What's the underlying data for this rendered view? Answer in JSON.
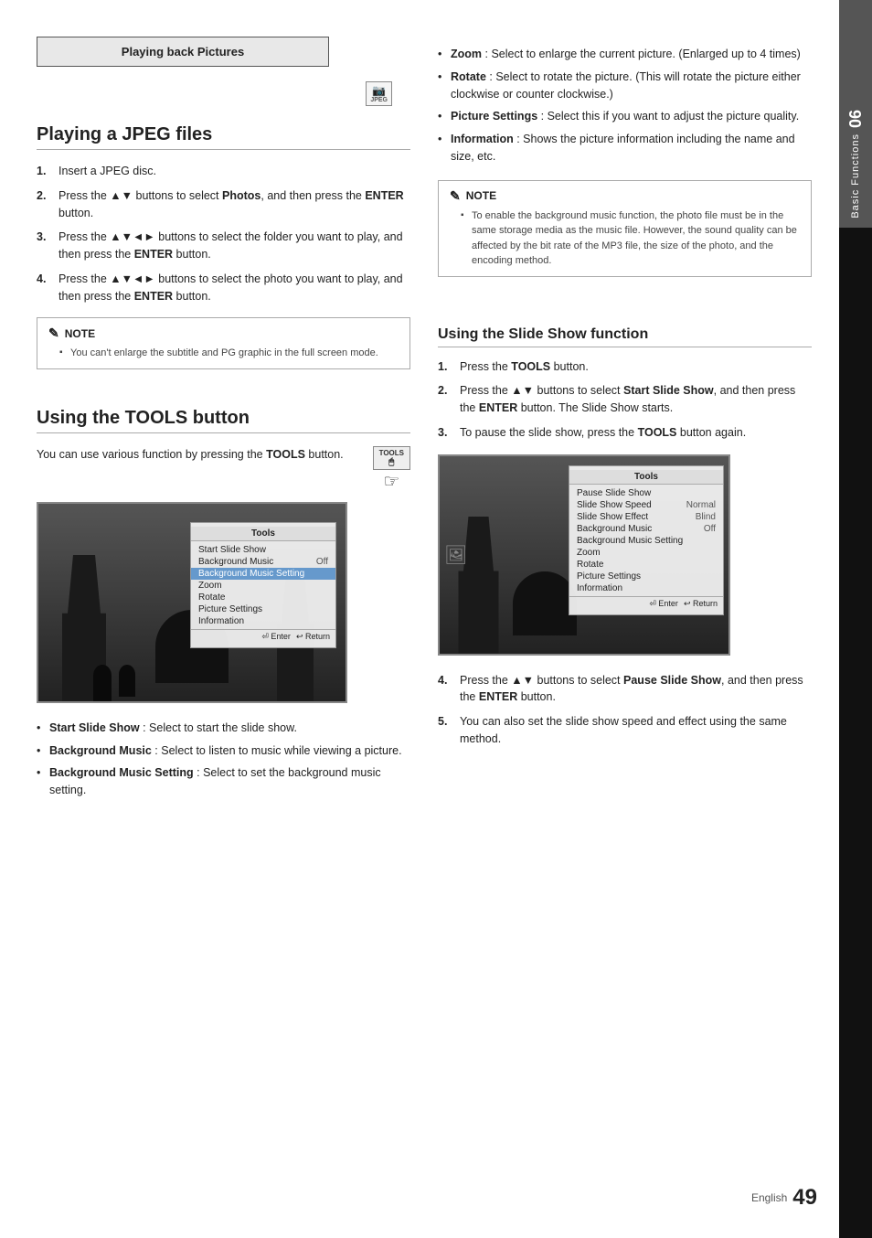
{
  "page": {
    "number": "49",
    "number_label": "English"
  },
  "side_tab": {
    "number": "06",
    "text": "Basic Functions"
  },
  "playing_back_box": {
    "title": "Playing back Pictures"
  },
  "jpeg_icon": {
    "label": "JPEG"
  },
  "left_section": {
    "title": "Playing a JPEG files",
    "steps": [
      {
        "num": "1.",
        "text": "Insert a JPEG disc."
      },
      {
        "num": "2.",
        "text": "Press the ▲▼ buttons to select Photos, and then press the ENTER button."
      },
      {
        "num": "3.",
        "text": "Press the ▲▼◄► buttons to select the folder you want to play, and then press the ENTER button."
      },
      {
        "num": "4.",
        "text": "Press the ▲▼◄► buttons to select the photo you want to play, and then press the ENTER button."
      }
    ],
    "note_title": "NOTE",
    "note_items": [
      "You can't enlarge the subtitle and PG graphic in the full screen mode."
    ]
  },
  "tools_section": {
    "title": "Using the TOOLS button",
    "intro": "You can use various function by pressing the TOOLS button.",
    "tools_label": "TOOLS",
    "popup": {
      "title": "Tools",
      "items": [
        {
          "text": "Start Slide Show",
          "value": "",
          "highlighted": false
        },
        {
          "text": "Background Music",
          "value": "Off",
          "highlighted": false
        },
        {
          "text": "Background Music Setting",
          "value": "",
          "highlighted": true
        },
        {
          "text": "Zoom",
          "value": "",
          "highlighted": false
        },
        {
          "text": "Rotate",
          "value": "",
          "highlighted": false
        },
        {
          "text": "Picture Settings",
          "value": "",
          "highlighted": false
        },
        {
          "text": "Information",
          "value": "",
          "highlighted": false
        }
      ],
      "footer_enter": "⏎ Enter",
      "footer_return": "↩ Return"
    },
    "bullets": [
      {
        "label": "Start Slide Show",
        "text": ": Select to start the slide show."
      },
      {
        "label": "Background Music",
        "text": ": Select to listen to music while viewing a picture."
      },
      {
        "label": "Background Music Setting",
        "text": ": Select to set the background music setting."
      }
    ]
  },
  "right_section": {
    "bullets": [
      {
        "label": "Zoom",
        "text": ": Select to enlarge the current picture. (Enlarged up to 4 times)"
      },
      {
        "label": "Rotate",
        "text": ": Select to rotate the picture. (This will rotate the picture either clockwise or counter clockwise.)"
      },
      {
        "label": "Picture Settings",
        "text": ": Select this if you want to adjust the picture quality."
      },
      {
        "label": "Information",
        "text": ": Shows the picture information including the name and size, etc."
      }
    ],
    "note_title": "NOTE",
    "note_items": [
      "To enable the background music function, the photo file must be in the same storage media as the music file. However, the sound quality can be affected by the bit rate of the MP3 file, the size of the photo, and the encoding method."
    ],
    "slide_show_section": {
      "title": "Using the Slide Show function",
      "steps": [
        {
          "num": "1.",
          "text": "Press the TOOLS button."
        },
        {
          "num": "2.",
          "text": "Press the ▲▼ buttons to select Start Slide Show, and then press the ENTER button. The Slide Show starts."
        },
        {
          "num": "3.",
          "text": "To pause the slide show, press the TOOLS button again."
        }
      ],
      "popup": {
        "title": "Tools",
        "items": [
          {
            "text": "Pause Slide Show",
            "value": "",
            "highlighted": false
          },
          {
            "text": "Slide Show Speed",
            "value": "Normal",
            "highlighted": false
          },
          {
            "text": "Slide Show Effect",
            "value": "Blind",
            "highlighted": false
          },
          {
            "text": "Background Music",
            "value": "Off",
            "highlighted": false
          },
          {
            "text": "Background Music Setting",
            "value": "",
            "highlighted": false
          },
          {
            "text": "Zoom",
            "value": "",
            "highlighted": false
          },
          {
            "text": "Rotate",
            "value": "",
            "highlighted": false
          },
          {
            "text": "Picture Settings",
            "value": "",
            "highlighted": false
          },
          {
            "text": "Information",
            "value": "",
            "highlighted": false
          }
        ],
        "footer_enter": "⏎ Enter",
        "footer_return": "↩ Return"
      },
      "steps_after": [
        {
          "num": "4.",
          "text": "Press the ▲▼ buttons to select Pause Slide Show, and then press the ENTER button."
        },
        {
          "num": "5.",
          "text": "You can also set the slide show speed and effect using the same method."
        }
      ]
    }
  }
}
